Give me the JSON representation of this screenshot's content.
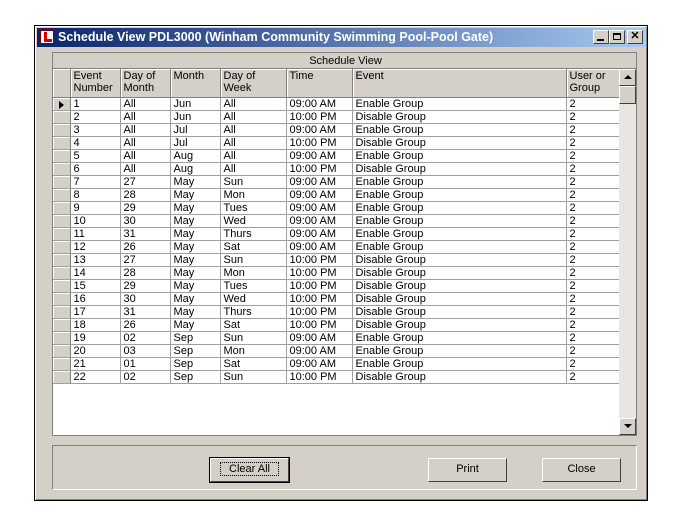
{
  "window": {
    "title": "Schedule View PDL3000 (Winham Community Swimming Pool-Pool Gate)"
  },
  "grid": {
    "caption": "Schedule View",
    "columns": [
      "Event Number",
      "Day of Month",
      "Month",
      "Day of Week",
      "Time",
      "Event",
      "User or Group"
    ],
    "rows": [
      [
        "1",
        "All",
        "Jun",
        "All",
        "09:00 AM",
        "Enable Group",
        "2"
      ],
      [
        "2",
        "All",
        "Jun",
        "All",
        "10:00 PM",
        "Disable Group",
        "2"
      ],
      [
        "3",
        "All",
        "Jul",
        "All",
        "09:00 AM",
        "Enable Group",
        "2"
      ],
      [
        "4",
        "All",
        "Jul",
        "All",
        "10:00 PM",
        "Disable Group",
        "2"
      ],
      [
        "5",
        "All",
        "Aug",
        "All",
        "09:00 AM",
        "Enable Group",
        "2"
      ],
      [
        "6",
        "All",
        "Aug",
        "All",
        "10:00 PM",
        "Disable Group",
        "2"
      ],
      [
        "7",
        "27",
        "May",
        "Sun",
        "09:00 AM",
        "Enable Group",
        "2"
      ],
      [
        "8",
        "28",
        "May",
        "Mon",
        "09:00 AM",
        "Enable Group",
        "2"
      ],
      [
        "9",
        "29",
        "May",
        "Tues",
        "09:00 AM",
        "Enable Group",
        "2"
      ],
      [
        "10",
        "30",
        "May",
        "Wed",
        "09:00 AM",
        "Enable Group",
        "2"
      ],
      [
        "11",
        "31",
        "May",
        "Thurs",
        "09:00 AM",
        "Enable Group",
        "2"
      ],
      [
        "12",
        "26",
        "May",
        "Sat",
        "09:00 AM",
        "Enable Group",
        "2"
      ],
      [
        "13",
        "27",
        "May",
        "Sun",
        "10:00 PM",
        "Disable Group",
        "2"
      ],
      [
        "14",
        "28",
        "May",
        "Mon",
        "10:00 PM",
        "Disable Group",
        "2"
      ],
      [
        "15",
        "29",
        "May",
        "Tues",
        "10:00 PM",
        "Disable Group",
        "2"
      ],
      [
        "16",
        "30",
        "May",
        "Wed",
        "10:00 PM",
        "Disable Group",
        "2"
      ],
      [
        "17",
        "31",
        "May",
        "Thurs",
        "10:00 PM",
        "Disable Group",
        "2"
      ],
      [
        "18",
        "26",
        "May",
        "Sat",
        "10:00 PM",
        "Disable Group",
        "2"
      ],
      [
        "19",
        "02",
        "Sep",
        "Sun",
        "09:00 AM",
        "Enable Group",
        "2"
      ],
      [
        "20",
        "03",
        "Sep",
        "Mon",
        "09:00 AM",
        "Enable Group",
        "2"
      ],
      [
        "21",
        "01",
        "Sep",
        "Sat",
        "09:00 AM",
        "Enable Group",
        "2"
      ],
      [
        "22",
        "02",
        "Sep",
        "Sun",
        "10:00 PM",
        "Disable Group",
        "2"
      ]
    ]
  },
  "buttons": {
    "clear_all": "Clear All",
    "print": "Print",
    "close": "Close"
  }
}
